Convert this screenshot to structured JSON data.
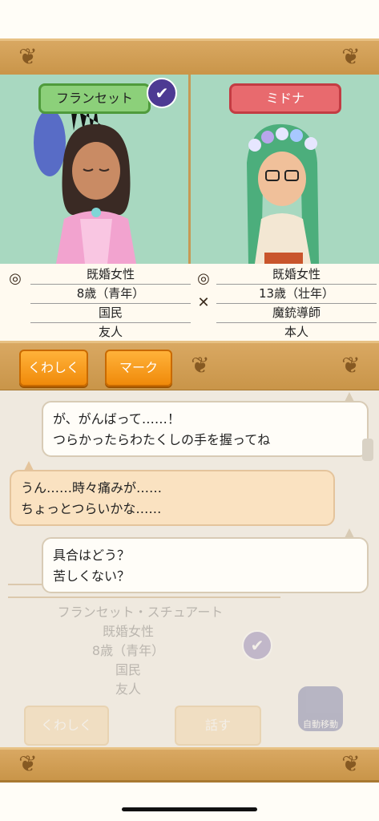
{
  "header": {
    "corner_icon": "ornament-scroll-icon"
  },
  "left_character": {
    "name": "フランセット",
    "badge_icon": "check-icon",
    "info": [
      "既婚女性",
      "8歳（青年）",
      "国民",
      "友人"
    ],
    "row_icons": [
      "ring-icon"
    ]
  },
  "right_character": {
    "name": "ミドナ",
    "info": [
      "既婚女性",
      "13歳（壮年）",
      "魔銃導師",
      "本人"
    ],
    "row_icons": [
      "ring-icon",
      "crossed-guns-icon"
    ]
  },
  "toolbar": {
    "details_label": "くわしく",
    "mark_label": "マーク"
  },
  "chat": {
    "messages": [
      {
        "speaker": "right",
        "lines": [
          "が、がんばって……！",
          "つらかったらわたくしの手を握ってね"
        ]
      },
      {
        "speaker": "left",
        "lines": [
          "うん……時々痛みが……",
          "ちょっとつらいかな……"
        ]
      },
      {
        "speaker": "right",
        "lines": [
          "具合はどう？",
          "苦しくない？"
        ]
      }
    ]
  },
  "background_card": {
    "full_name": "フランセット・スチュアート",
    "info": [
      "既婚女性",
      "8歳（青年）",
      "国民",
      "友人"
    ],
    "details_label": "くわしく",
    "talk_label": "話す",
    "auto_label": "自動移動"
  },
  "colors": {
    "accent_orange": "#f08a0a",
    "name_green": "#8cd07a",
    "name_red": "#e86a6e",
    "frame_gold": "#d9a862",
    "portrait_bg": "#a8d8c0"
  }
}
